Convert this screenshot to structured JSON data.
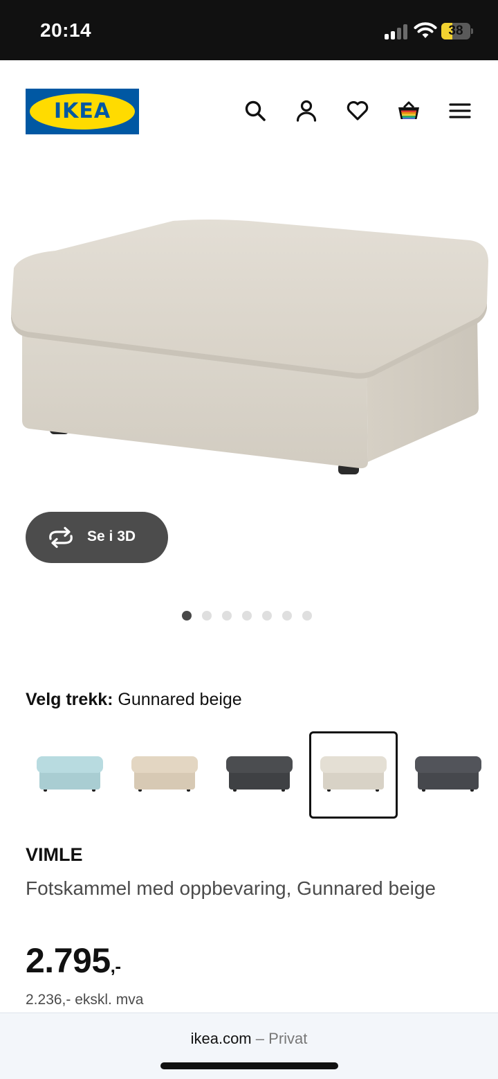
{
  "status_bar": {
    "time": "20:14",
    "battery_level": "38",
    "battery_fraction": 0.38,
    "icons": [
      "cellular-signal-icon",
      "wifi-icon",
      "battery-icon"
    ]
  },
  "header": {
    "logo_text": "IKEA",
    "logo_colors": {
      "blue": "#0058a3",
      "yellow": "#ffdb00"
    },
    "icons": [
      "search-icon",
      "account-icon",
      "favorites-heart-icon",
      "shopping-bag-icon",
      "menu-icon"
    ]
  },
  "gallery": {
    "see_in_3d_label": "Se i 3D",
    "image_count": 7,
    "active_index": 0
  },
  "fabric": {
    "label_prefix": "Velg trekk:",
    "selected_name": "Gunnared beige",
    "swatches": [
      {
        "color": "#b8dbe0",
        "shade": "#a9cdd2"
      },
      {
        "color": "#e3d6c2",
        "shade": "#d7c9b4"
      },
      {
        "color": "#4b4d50",
        "shade": "#3f4144"
      },
      {
        "color": "#e4dfd4",
        "shade": "#d8d2c6",
        "selected": true
      },
      {
        "color": "#52545a",
        "shade": "#46484d"
      }
    ]
  },
  "product": {
    "name": "VIMLE",
    "description": "Fotskammel med oppbevaring, Gunnared beige",
    "price": "2.795",
    "price_suffix": ",-",
    "price_excl_vat": "2.236,- ekskl. mva"
  },
  "browser": {
    "domain": "ikea.com",
    "separator": "–",
    "mode": "Privat"
  }
}
